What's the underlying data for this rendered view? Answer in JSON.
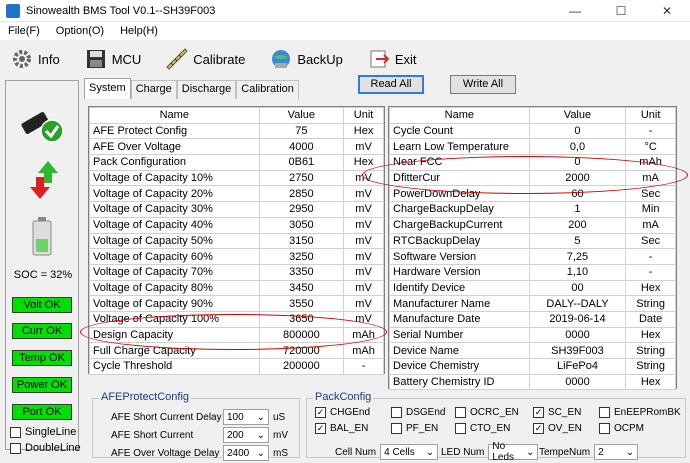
{
  "window": {
    "title": "Sinowealth BMS Tool V0.1--SH39F003",
    "minimize": "—",
    "maximize": "☐",
    "close": "✕"
  },
  "menu": [
    "File(F)",
    "Option(O)",
    "Help(H)"
  ],
  "toolbar": [
    {
      "label": "Info",
      "icon": "gear-icon"
    },
    {
      "label": "MCU",
      "icon": "floppy-icon"
    },
    {
      "label": "Calibrate",
      "icon": "ruler-icon"
    },
    {
      "label": "BackUp",
      "icon": "globe-icon"
    },
    {
      "label": "Exit",
      "icon": "exit-icon"
    }
  ],
  "left": {
    "soc": "SOC = 32%",
    "status": [
      "Volt OK",
      "Curr OK",
      "Temp OK",
      "Power OK",
      "Port OK"
    ],
    "checks": [
      "SingleLine",
      "DoubleLine"
    ]
  },
  "tabs": [
    "System",
    "Charge",
    "Discharge",
    "Calibration"
  ],
  "buttons": {
    "read": "Read All",
    "write": "Write All"
  },
  "table_headers": [
    "Name",
    "Value",
    "Unit"
  ],
  "table_left": [
    [
      "AFE Protect Config",
      "75",
      "Hex"
    ],
    [
      "AFE Over Voltage",
      "4000",
      "mV"
    ],
    [
      "Pack Configuration",
      "0B61",
      "Hex"
    ],
    [
      "Voltage of Capacity 10%",
      "2750",
      "mV"
    ],
    [
      "Voltage of Capacity 20%",
      "2850",
      "mV"
    ],
    [
      "Voltage of Capacity 30%",
      "2950",
      "mV"
    ],
    [
      "Voltage of Capacity 40%",
      "3050",
      "mV"
    ],
    [
      "Voltage of Capacity 50%",
      "3150",
      "mV"
    ],
    [
      "Voltage of Capacity 60%",
      "3250",
      "mV"
    ],
    [
      "Voltage of Capacity 70%",
      "3350",
      "mV"
    ],
    [
      "Voltage of Capacity 80%",
      "3450",
      "mV"
    ],
    [
      "Voltage of Capacity 90%",
      "3550",
      "mV"
    ],
    [
      "Voltage of Capacity 100%",
      "3650",
      "mV"
    ],
    [
      "Design Capacity",
      "800000",
      "mAh"
    ],
    [
      "Full Charge Capacity",
      "720000",
      "mAh"
    ],
    [
      "Cycle Threshold",
      "200000",
      "-"
    ]
  ],
  "table_right": [
    [
      "Cycle Count",
      "0",
      "-"
    ],
    [
      "Learn Low Temperature",
      "0,0",
      "°C"
    ],
    [
      "Near FCC",
      "0",
      "mAh"
    ],
    [
      "DfitterCur",
      "2000",
      "mA"
    ],
    [
      "PowerDownDelay",
      "60",
      "Sec"
    ],
    [
      "ChargeBackupDelay",
      "1",
      "Min"
    ],
    [
      "ChargeBackupCurrent",
      "200",
      "mA"
    ],
    [
      "RTCBackupDelay",
      "5",
      "Sec"
    ],
    [
      "Software Version",
      "7,25",
      "-"
    ],
    [
      "Hardware Version",
      "1,10",
      "-"
    ],
    [
      "Identify Device",
      "00",
      "Hex"
    ],
    [
      "Manufacturer Name",
      "DALY--DALY",
      "String"
    ],
    [
      "Manufacture Date",
      "2019-06-14",
      "Date"
    ],
    [
      "Serial Number",
      "0000",
      "Hex"
    ],
    [
      "Device Name",
      "SH39F003",
      "String"
    ],
    [
      "Device Chemistry",
      "LiFePo4",
      "String"
    ],
    [
      "Battery Chemistry ID",
      "0000",
      "Hex"
    ]
  ],
  "afe": {
    "legend": "AFEProtectConfig",
    "rows": [
      {
        "label": "AFE Short Current Delay",
        "value": "100",
        "unit": "uS"
      },
      {
        "label": "AFE Short Current",
        "value": "200",
        "unit": "mV"
      },
      {
        "label": "AFE Over Voltage Delay",
        "value": "2400",
        "unit": "mS"
      }
    ]
  },
  "pack": {
    "legend": "PackConfig",
    "checks": [
      {
        "label": "CHGEnd",
        "checked": true
      },
      {
        "label": "DSGEnd",
        "checked": false
      },
      {
        "label": "OCRC_EN",
        "checked": false
      },
      {
        "label": "SC_EN",
        "checked": true
      },
      {
        "label": "EnEEPRomBK",
        "checked": false
      },
      {
        "label": "BAL_EN",
        "checked": true
      },
      {
        "label": "PF_EN",
        "checked": false
      },
      {
        "label": "CTO_EN",
        "checked": false
      },
      {
        "label": "OV_EN",
        "checked": true
      },
      {
        "label": "OCPM",
        "checked": false
      }
    ],
    "selects": [
      {
        "label": "Cell Num",
        "value": "4 Cells"
      },
      {
        "label": "LED Num",
        "value": "No Leds"
      },
      {
        "label": "TempeNum",
        "value": "2"
      }
    ]
  }
}
